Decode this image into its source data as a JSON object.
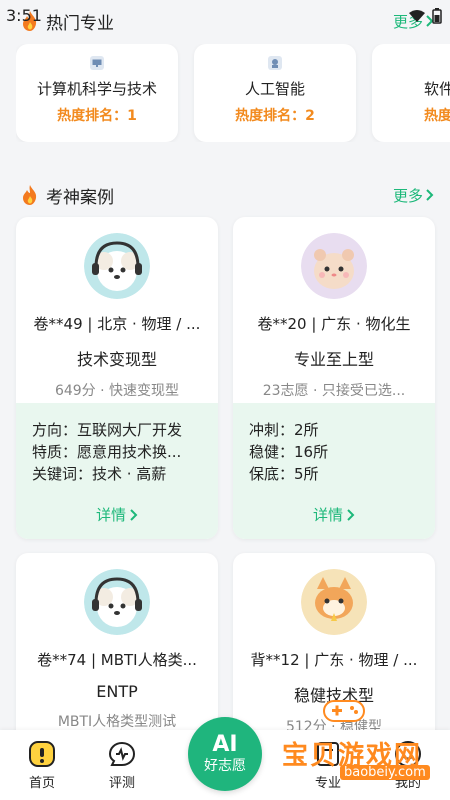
{
  "status_bar": {
    "time": "3:51"
  },
  "hot_section": {
    "title": "热门专业",
    "more": "更多",
    "cards": [
      {
        "name": "计算机科学与技术",
        "rank": "热度排名：1"
      },
      {
        "name": "人工智能",
        "rank": "热度排名：2"
      },
      {
        "name": "软件",
        "rank": "热度排"
      }
    ]
  },
  "case_section": {
    "title": "考神案例",
    "more": "更多",
    "cards": [
      {
        "meta": "卷**49 | 北京 · 物理 / ...",
        "type": "技术变现型",
        "sub": "649分 · 快速变现型",
        "lines": [
          "方向：互联网大厂开发",
          "特质：愿意用技术换...",
          "关键词：技术 · 高薪"
        ],
        "detail": "详情"
      },
      {
        "meta": "卷**20 | 广东 · 物化生",
        "type": "专业至上型",
        "sub": "23志愿 · 只接受已选...",
        "lines": [
          "冲刺：2所",
          "稳健：16所",
          "保底：5所"
        ],
        "detail": "详情"
      },
      {
        "meta": "卷**74 | MBTI人格类...",
        "type": "ENTP",
        "sub": "MBTI人格类型测试"
      },
      {
        "meta": "背**12 | 广东 · 物理 / ...",
        "type": "稳健技术型",
        "sub": "512分 · 稳健型"
      }
    ]
  },
  "tab_bar": {
    "home": "首页",
    "assess": "评测",
    "ai_top": "AI",
    "ai_bottom": "好志愿",
    "major": "专业",
    "mine": "我的"
  },
  "watermark": {
    "text": "宝贝游戏网",
    "url": "baobeiy.com"
  },
  "colors": {
    "accent": "#1db87a",
    "rank": "#f28a1e",
    "watermark": "#ff8a1f"
  }
}
